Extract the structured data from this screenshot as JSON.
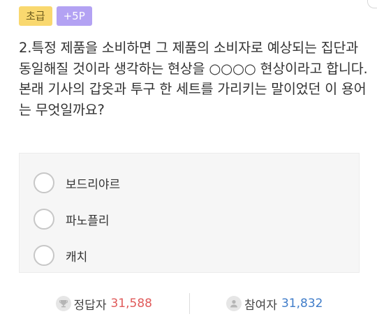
{
  "badges": {
    "level": "초급",
    "points": "+5P"
  },
  "question": {
    "text": "2.특정 제품을 소비하면 그 제품의 소비자로 예상되는 집단과 동일해질 것이라 생각하는 현상을 ○○○○ 현상이라고 합니다. 본래 기사의 갑옷과 투구 한 세트를 가리키는 말이었던 이 용어는 무엇일까요?"
  },
  "options": [
    {
      "label": "보드리야르"
    },
    {
      "label": "파노플리"
    },
    {
      "label": "캐치"
    }
  ],
  "stats": {
    "correct_label": "정답자",
    "correct_count": "31,588",
    "participants_label": "참여자",
    "participants_count": "31,832"
  },
  "colors": {
    "level_badge": "#f9d86f",
    "points_badge": "#b3a2f3",
    "correct_value": "#e05a5a",
    "participants_value": "#3f7cc9"
  },
  "icons": {
    "correct": "trophy-icon",
    "participants": "person-icon"
  }
}
